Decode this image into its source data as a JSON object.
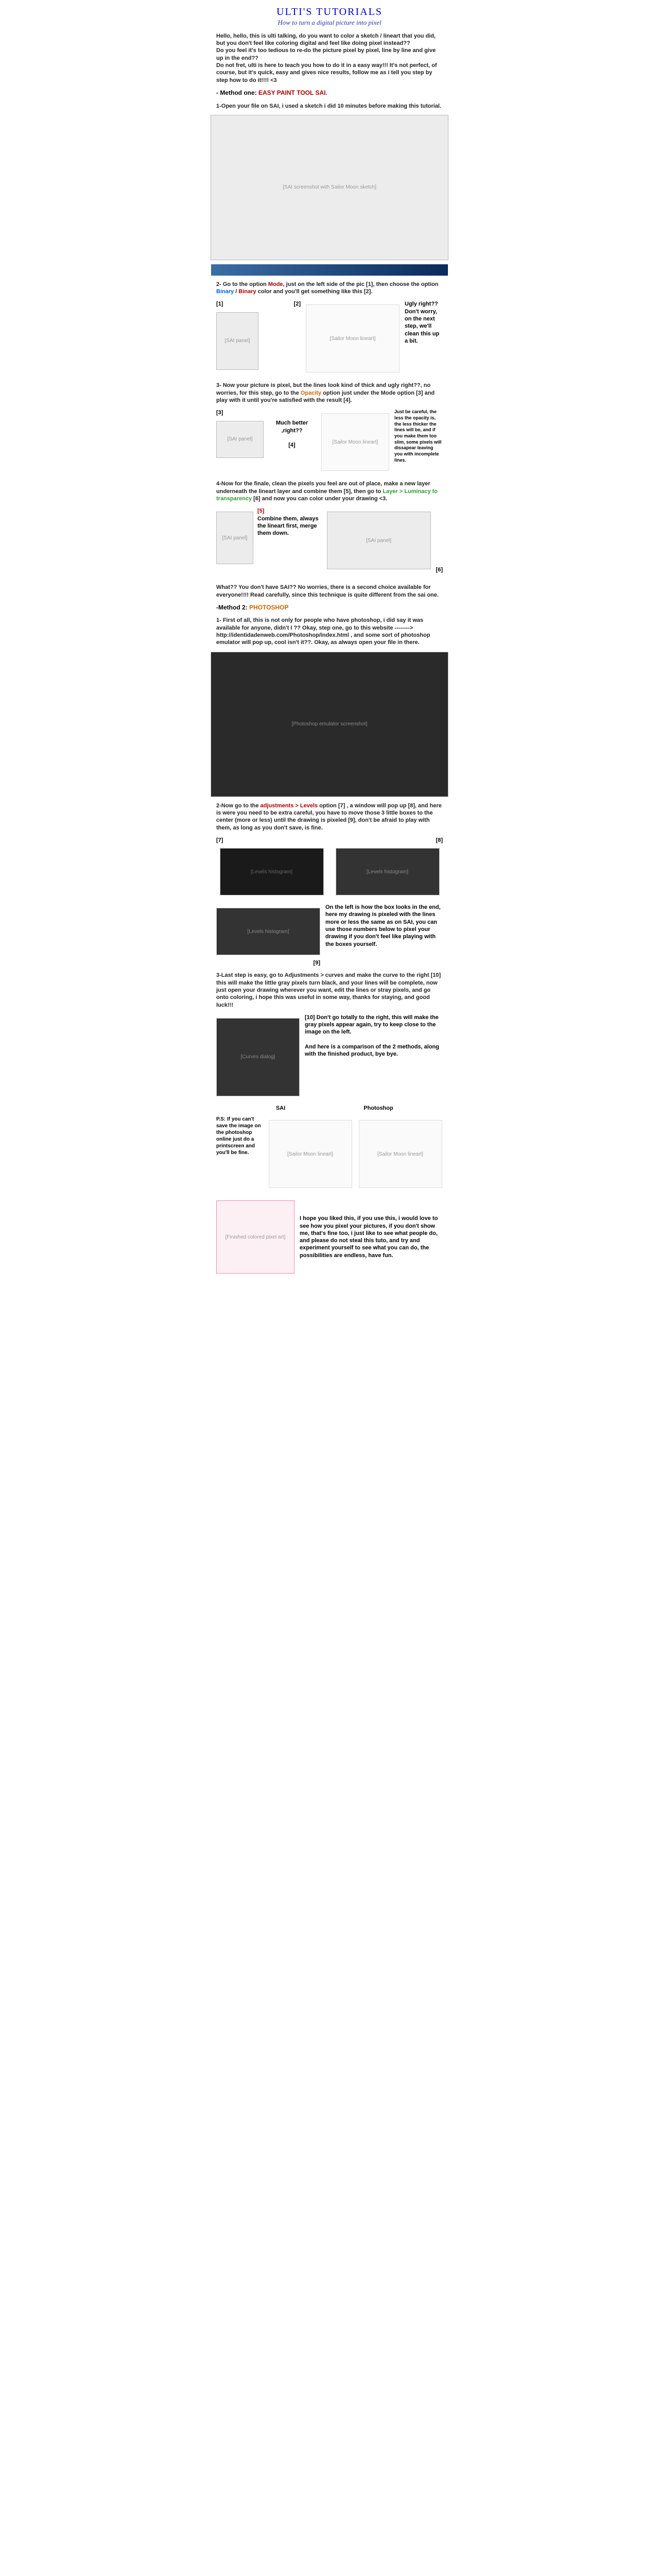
{
  "header": {
    "title": "ULTI'S TUTORIALS",
    "subtitle": "How to turn a digital picture into pixel"
  },
  "intro": {
    "p1": "Hello, hello, this is ulti talking, do you want to color a sketch / lineart that you did, but you don't feel like coloring digital and feel like doing pixel instead??",
    "p2": "Do you feel it's too tedious to re-do the picture pixel by pixel, line by line and give up in the end??",
    "p3": "Do not fret, ulti is here to teach you how to do it in a easy way!!! It's not perfect, of course, but it's quick, easy and gives nice results, follow me as i tell you step by step how to do it!!!! <3"
  },
  "method1": {
    "heading_pre": "- Method one: ",
    "heading": "EASY PAINT TOOL SAI.",
    "step1": "1-Open your file on SAI, i used a sketch i did 10 minutes before making this tutorial.",
    "step2_pre": "2- Go to the option ",
    "step2_mode": "Mode",
    "step2_mid": ", just on the left side of the pic [1], then choose the option ",
    "step2_bin1": "Binary",
    "step2_slash": " / ",
    "step2_bin2": "Binary",
    "step2_end": " color and you'll get something like this [2].",
    "label1": "[1]",
    "label2": "[2]",
    "ugly": "Ugly right?? Don't worry, on the next step, we'll clean this up a bit.",
    "step3_pre": "3- Now your picture is pixel, but the lines look kind of thick and ugly right??, no worries, for this step, go to the  ",
    "step3_opacity": "Opacity",
    "step3_end": " option just under the Mode option [3] and play with it until you're satisfied with the result [4].",
    "label3": "[3]",
    "better": "Much better ,right??",
    "label4": "[4]",
    "careful": "Just be careful, the less the opacity is, the less thicker the lines will be, and if you make them too slim, some pixels will dissapear leaving you with incomplete lines.",
    "step4_pre": "4-Now for the finale, clean the pixels you feel are out of place, make a new layer underneath the lineart layer and combine them [5], then go to ",
    "step4_layer": "Layer > Luminacy to transparency",
    "step4_end": " [6] and now you can color under your drawing <3.",
    "label5": "[5]",
    "combine": "Combine them, always the lineart first, merge them down.",
    "label6": "[6]",
    "transition": "What?? You don't have SAI?? No worries, there is a second choice available for everyone!!!! Read carefully, since this technique is quite different from the sai one."
  },
  "method2": {
    "heading_pre": "-Method 2: ",
    "heading": "PHOTOSHOP",
    "step1": "1- First of all, this is not only for people who have photoshop, i did say it was available for anyone, didn't I ?? Okay, step one, go to this website --------> http://identidadenweb.com/Photoshop/index.html , and some sort of photoshop emulator will pop up, cool isn't it??. Okay, as always open your file in there.",
    "step2_pre": "2-Now go to the ",
    "step2_adjust": "adjustments > Levels",
    "step2_end": " option [7] , a window will pop up [8], and here is were you need to be extra careful, you have to move those 3 little boxes to the center (more or less) until the drawing is pixeled [9], don't be afraid to play with them, as long as you don't save, is fine.",
    "label7": "[7]",
    "label8": "[8]",
    "label9": "[9]",
    "onleft": "On the left is how the box looks in the end, here my drawing is pixeled with the lines more or less the same as on SAI, you can use those numbers below to pixel your drawing if you don't feel like playing with the boxes yourself.",
    "step3": "3-Last step is easy, go to Adjustments > curves and make the curve to the right [10] this will make the little gray pixels turn black, and your lines will be complete, now just open your drawing wherever you want, edit the lines or stray pixels, and go onto coloring, i hope this was useful in some way, thanks for staying, and good luck!!!",
    "label10": "[10]",
    "donttotal": "Don't go totally to the right, this will make the gray pixels appear again, try to keep close to the image on the left.",
    "comparison": "And here is a comparison of the 2 methods, along with the finished product, bye bye.",
    "sai_label": "SAI",
    "ps_label": "Photoshop",
    "ps_note": "P.S: If you can't save the image on the photoshop online just do a printscreen and you'll be fine.",
    "outro": "I hope you liked this, if you use this, i would love to see how you pixel your pictures, if you don't show me, that's fine too, i just like to see what people do, and please do not steal this tuto, and try and experiment yourself to see what you can do, the possibilities are endless, have fun."
  },
  "img": {
    "sai_main": "[SAI screenshot with Sailor Moon sketch]",
    "sketch_moon": "[Sailor Moon lineart]",
    "panel_small": "[SAI panel]",
    "ps_main": "[Photoshop emulator screenshot]",
    "levels": "[Levels histogram]",
    "curves": "[Curves dialog]",
    "colored": "[Finished colored pixel art]"
  }
}
